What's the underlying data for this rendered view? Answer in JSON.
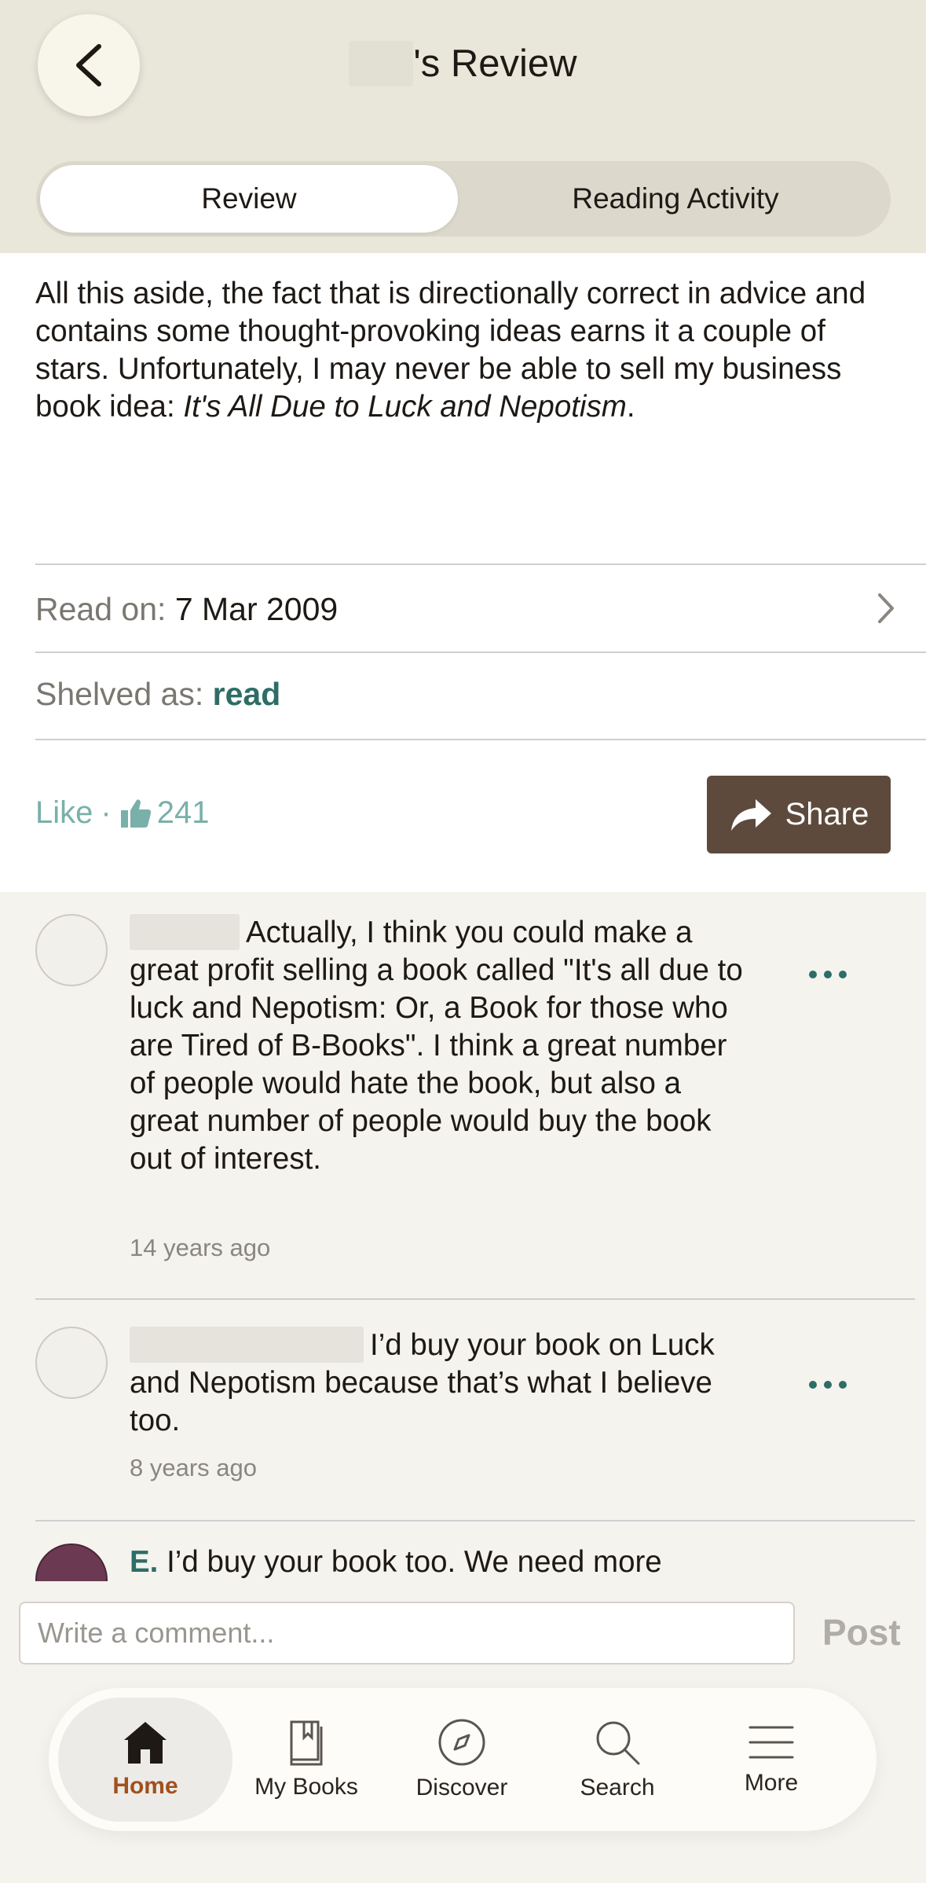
{
  "header": {
    "title_suffix": "'s Review",
    "back_icon": "chevron-left-icon"
  },
  "tabs": [
    {
      "label": "Review",
      "active": true
    },
    {
      "label": "Reading Activity",
      "active": false
    }
  ],
  "review": {
    "text_plain": "All this aside, the fact that is directionally correct in advice and contains some thought-provoking ideas earns it a couple of stars. Unfortunately, I may never be able to sell my business book idea: ",
    "text_italic": "It's All Due to Luck and Nepotism",
    "text_end": "."
  },
  "read_on": {
    "label": "Read on:",
    "value": "7 Mar 2009"
  },
  "shelved_as": {
    "label": "Shelved as:",
    "value": "read"
  },
  "like": {
    "label": "Like",
    "separator": "·",
    "count": "241"
  },
  "share": {
    "label": "Share"
  },
  "comments": [
    {
      "text": "Actually, I think you could make a great profit selling a book called \"It's all due to luck and Nepotism: Or, a Book for those who are Tired of B-Books\". I think a great number of people would hate the book, but also a great number of people would buy the book out of interest.",
      "time": "14 years ago"
    },
    {
      "text": "I’d buy your book on Luck and Nepotism because that’s what I believe too.",
      "time": "8 years ago"
    },
    {
      "author": "E.",
      "text": "I’d buy your book too. We need more"
    }
  ],
  "comment_input": {
    "placeholder": "Write a comment...",
    "value": ""
  },
  "post": {
    "label": "Post"
  },
  "nav": [
    {
      "label": "Home",
      "icon": "home-icon",
      "active": true
    },
    {
      "label": "My Books",
      "icon": "book-icon",
      "active": false
    },
    {
      "label": "Discover",
      "icon": "compass-icon",
      "active": false
    },
    {
      "label": "Search",
      "icon": "search-icon",
      "active": false
    },
    {
      "label": "More",
      "icon": "menu-icon",
      "active": false
    }
  ],
  "colors": {
    "header_bg": "#e9e6da",
    "accent_teal": "#2e6d66",
    "share_brown": "#5d4a3c",
    "nav_active": "#a0501d"
  }
}
